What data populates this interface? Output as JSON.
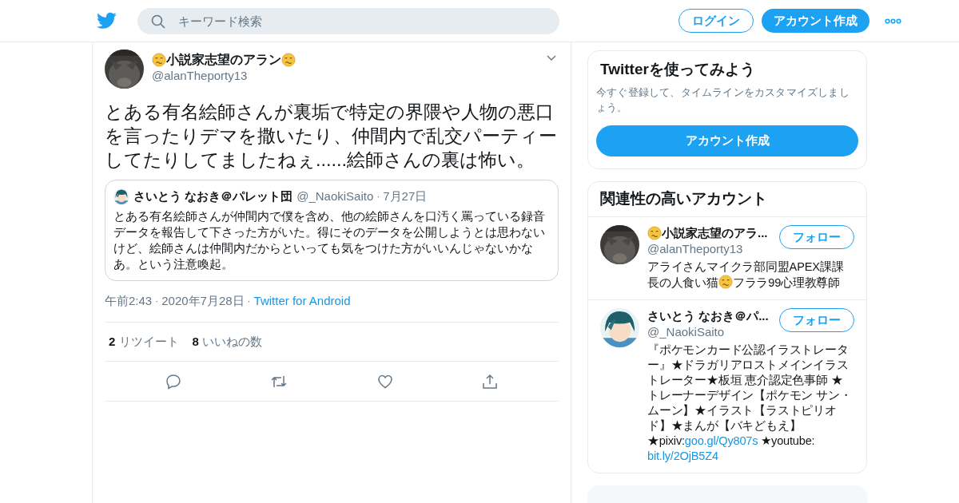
{
  "header": {
    "search": {
      "placeholder": "キーワード検索"
    },
    "login_button": "ログイン",
    "signup_button": "アカウント作成"
  },
  "tweet": {
    "author": {
      "name": [
        {
          "kind": "emoji"
        },
        {
          "kind": "text",
          "text": "小説家志望のアラン"
        },
        {
          "kind": "emoji"
        }
      ],
      "handle": "@alanTheporty13"
    },
    "text": "とある有名絵師さんが裏垢で特定の界隈や人物の悪口を言ったりデマを撒いたり、仲間内で乱交パーティーしてたりしてましたねぇ......絵師さんの裏は怖い。",
    "quote": {
      "name": "さいとう なおき＠パレット団",
      "handle": "@_NaokiSaito",
      "separator": "·",
      "date": "7月27日",
      "text": "とある有名絵師さんが仲間内で僕を含め、他の絵師さんを口汚く罵っている録音データを報告して下さった方がいた。得にそのデータを公開しようとは思わないけど、絵師さんは仲間内だからといっても気をつけた方がいいんじゃないかなあ。という注意喚起。"
    },
    "meta": [
      {
        "kind": "text",
        "text": "午前2:43"
      },
      {
        "kind": "separator",
        "text": "·"
      },
      {
        "kind": "text",
        "text": "2020年7月28日"
      },
      {
        "kind": "separator",
        "text": "·"
      },
      {
        "kind": "link",
        "text": "Twitter for Android"
      }
    ],
    "stats": [
      {
        "count": "2",
        "label": "リツイート"
      },
      {
        "count": "8",
        "label": "いいねの数"
      }
    ]
  },
  "signup_card": {
    "title": "Twitterを使ってみよう",
    "text": "今すぐ登録して、タイムラインをカスタマイズしましょう。",
    "button": "アカウント作成"
  },
  "related": {
    "title": "関連性の高いアカウント",
    "accounts": [
      {
        "name": [
          {
            "kind": "emoji"
          },
          {
            "kind": "text",
            "text": "小説家志望のアラ..."
          }
        ],
        "handle": "@alanTheporty13",
        "follow": "フォロー",
        "bio": [
          {
            "kind": "text",
            "text": "アライさんマイクラ部同盟APEX課課長の人食い猫"
          },
          {
            "kind": "emoji"
          },
          {
            "kind": "text",
            "text": "フララ99心理教尊師"
          }
        ]
      },
      {
        "name": [
          {
            "kind": "text",
            "text": "さいとう なおき＠パ..."
          }
        ],
        "handle": "@_NaokiSaito",
        "follow": "フォロー",
        "bio": [
          {
            "kind": "text",
            "text": "『ポケモンカード公認イラストレーター』★ドラガリアロストメインイラストレーター★板垣 恵介認定色事師 ★トレーナーデザイン【ポケモン サン・ムーン】★イラスト【ラストピリオド】★まんが【バキどもえ】★pixiv:"
          },
          {
            "kind": "link",
            "text": "goo.gl/Qy807s"
          },
          {
            "kind": "text",
            "text": " ★youtube: "
          },
          {
            "kind": "link",
            "text": "bit.ly/2OjB5Z4"
          }
        ]
      }
    ]
  }
}
